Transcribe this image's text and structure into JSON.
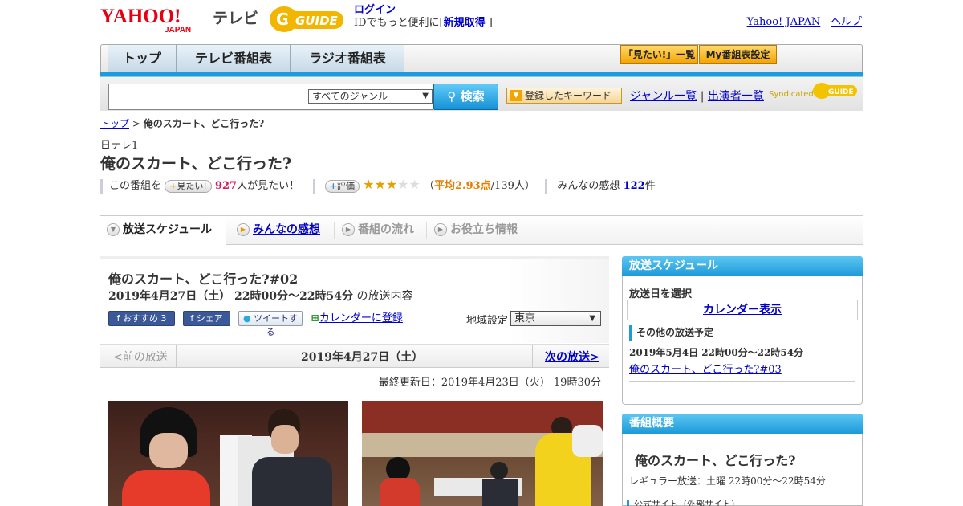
{
  "header": {
    "service_label": "テレビ",
    "login_link": "ログイン",
    "login_prompt": "IDでもっと便利に[",
    "register_link": "新規取得",
    "register_close": "]",
    "yahoo_japan_link": "Yahoo! JAPAN",
    "separator": "-",
    "help_link": "ヘルプ",
    "logo_text": "YAHOO!",
    "logo_sub": "JAPAN",
    "gguide_text": "GUIDE"
  },
  "nav": {
    "tabs": [
      "トップ",
      "テレビ番組表",
      "ラジオ番組表"
    ],
    "want_list_button": "「見たい!」一覧",
    "my_schedule_button": "My番組表設定"
  },
  "search": {
    "genre_selected": "すべてのジャンル",
    "search_button": "検索",
    "keyword_button": "登録したキーワード",
    "genre_list_link": "ジャンル一覧",
    "link_separator": "|",
    "cast_list_link": "出演者一覧",
    "syndicated": "Syndicated"
  },
  "breadcrumb": {
    "top": "トップ",
    "sep": ">",
    "current": "俺のスカート、どこ行った?"
  },
  "program": {
    "channel": "日テレ1",
    "title": "俺のスカート、どこ行った?",
    "want_prefix": "この番組を",
    "want_button": "見たい!",
    "want_count": "927",
    "want_suffix": "人が見たい！",
    "rating_button": "評価",
    "rating_value": 2.93,
    "rating_open": "（",
    "rating_avg": "平均2.93点",
    "rating_count": "/139人）",
    "impressions_label": "みんなの感想",
    "impressions_count": "122",
    "impressions_suffix": "件"
  },
  "tabs": {
    "schedule": "放送スケジュール",
    "impressions": "みんなの感想",
    "flow": "番組の流れ",
    "info": "お役立ち情報"
  },
  "episode": {
    "title": "俺のスカート、どこ行った?#02",
    "time": "2019年4月27日（土） 22時00分～22時54分",
    "time_suffix": "の放送内容",
    "recommend": "おすすめ 3",
    "share": "シェア",
    "tweet": "ツイートする",
    "calendar": "カレンダーに登録",
    "region_label": "地域設定",
    "region_value": "東京",
    "prev": "<前の放送",
    "date": "2019年4月27日（土）",
    "next": "次の放送>",
    "updated": "最終更新日：2019年4月23日（火） 19時30分"
  },
  "sidebar": {
    "schedule_head": "放送スケジュール",
    "select_day": "放送日を選択",
    "calendar_link": "カレンダー表示",
    "other_head": "その他の放送予定",
    "other_date": "2019年5月4日 22時00分～22時54分",
    "other_link": "俺のスカート、どこ行った?#03",
    "summary_head": "番組概要",
    "summary_title": "俺のスカート、どこ行った?",
    "regular": "レギュラー放送：土曜 22時00分～22時54分",
    "official": "公式サイト（外部サイト）"
  },
  "colors": {
    "accent_blue": "#1c9be0",
    "link": "#0000cc",
    "orange_button": "#f5a300",
    "pink_count": "#d81b60"
  }
}
